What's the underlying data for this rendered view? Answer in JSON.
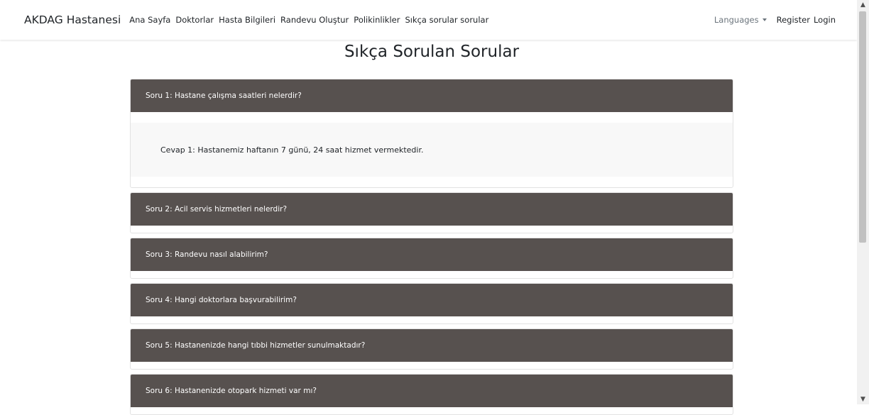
{
  "navbar": {
    "brand": "AKDAG Hastanesi",
    "links": [
      {
        "label": "Ana Sayfa"
      },
      {
        "label": "Doktorlar"
      },
      {
        "label": "Hasta Bilgileri"
      },
      {
        "label": "Randevu Oluştur"
      },
      {
        "label": "Polikinlikler"
      },
      {
        "label": "Sıkça sorular sorular"
      }
    ],
    "languages": "Languages",
    "register": "Register",
    "login": "Login"
  },
  "page": {
    "title": "Sıkça Sorulan Sorular"
  },
  "faq": [
    {
      "question": "Soru 1: Hastane çalışma saatleri nelerdir?",
      "answer": "Cevap 1: Hastanemiz haftanın 7 günü, 24 saat hizmet vermektedir.",
      "expanded": true
    },
    {
      "question": "Soru 2: Acil servis hizmetleri nelerdir?",
      "expanded": false
    },
    {
      "question": "Soru 3: Randevu nasıl alabilirim?",
      "expanded": false
    },
    {
      "question": "Soru 4: Hangi doktorlara başvurabilirim?",
      "expanded": false
    },
    {
      "question": "Soru 5: Hastanenizde hangi tıbbi hizmetler sunulmaktadır?",
      "expanded": false
    },
    {
      "question": "Soru 6: Hastanenizde otopark hizmeti var mı?",
      "expanded": false
    }
  ],
  "colors": {
    "header_bg": "#57514f",
    "answer_bg": "#f8f8f8"
  }
}
